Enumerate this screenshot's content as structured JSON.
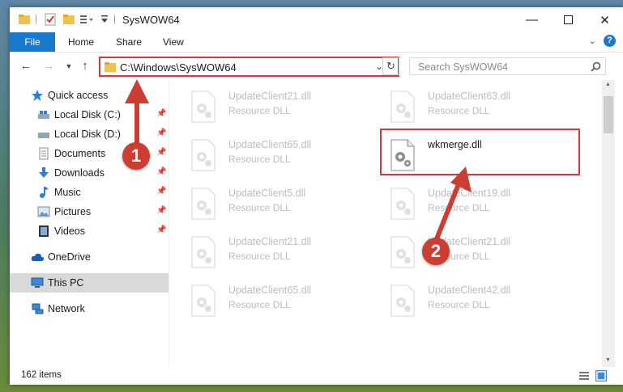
{
  "window": {
    "title": "SysWOW64"
  },
  "ribbon": {
    "tabs": [
      "File",
      "Home",
      "Share",
      "View"
    ]
  },
  "address": {
    "path": "C:\\Windows\\SysWOW64"
  },
  "search": {
    "placeholder": "Search SysWOW64"
  },
  "sidebar": {
    "quick_access": "Quick access",
    "items": [
      "Local Disk (C:)",
      "Local Disk (D:)",
      "Documents",
      "Downloads",
      "Music",
      "Pictures",
      "Videos"
    ],
    "onedrive": "OneDrive",
    "this_pc": "This PC",
    "network": "Network"
  },
  "files": [
    {
      "name": "UpdateClient21.dll",
      "type": "Resource DLL"
    },
    {
      "name": "UpdateClient63.dll",
      "type": "Resource DLL"
    },
    {
      "name": "UpdateClient65.dll",
      "type": "Resource DLL"
    },
    {
      "name": "wkmerge.dll",
      "type": ""
    },
    {
      "name": "UpdateClient5.dll",
      "type": "Resource DLL"
    },
    {
      "name": "UpdateClient19.dll",
      "type": "Resource DLL"
    },
    {
      "name": "UpdateClient21.dll",
      "type": "Resource DLL"
    },
    {
      "name": "UpdateClient21.dll",
      "type": "Resource DLL"
    },
    {
      "name": "UpdateClient65.dll",
      "type": "Resource DLL"
    },
    {
      "name": "UpdateClient42.dll",
      "type": "Resource DLL"
    }
  ],
  "status": {
    "count": "162 items"
  },
  "callouts": [
    "1",
    "2"
  ],
  "colors": {
    "accent": "#1979ca",
    "highlight": "#d9363e",
    "callout": "#cc3d33"
  }
}
